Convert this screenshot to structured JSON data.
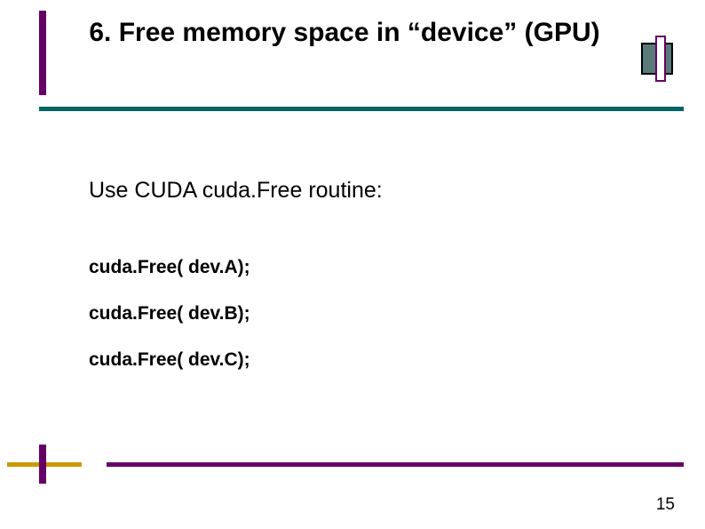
{
  "title": "6. Free memory space in “device” (GPU)",
  "body": {
    "intro": "Use CUDA cuda.Free routine:",
    "lines": [
      "cuda.Free( dev.A);",
      "cuda.Free( dev.B);",
      "cuda.Free( dev.C);"
    ]
  },
  "page_number": "15"
}
